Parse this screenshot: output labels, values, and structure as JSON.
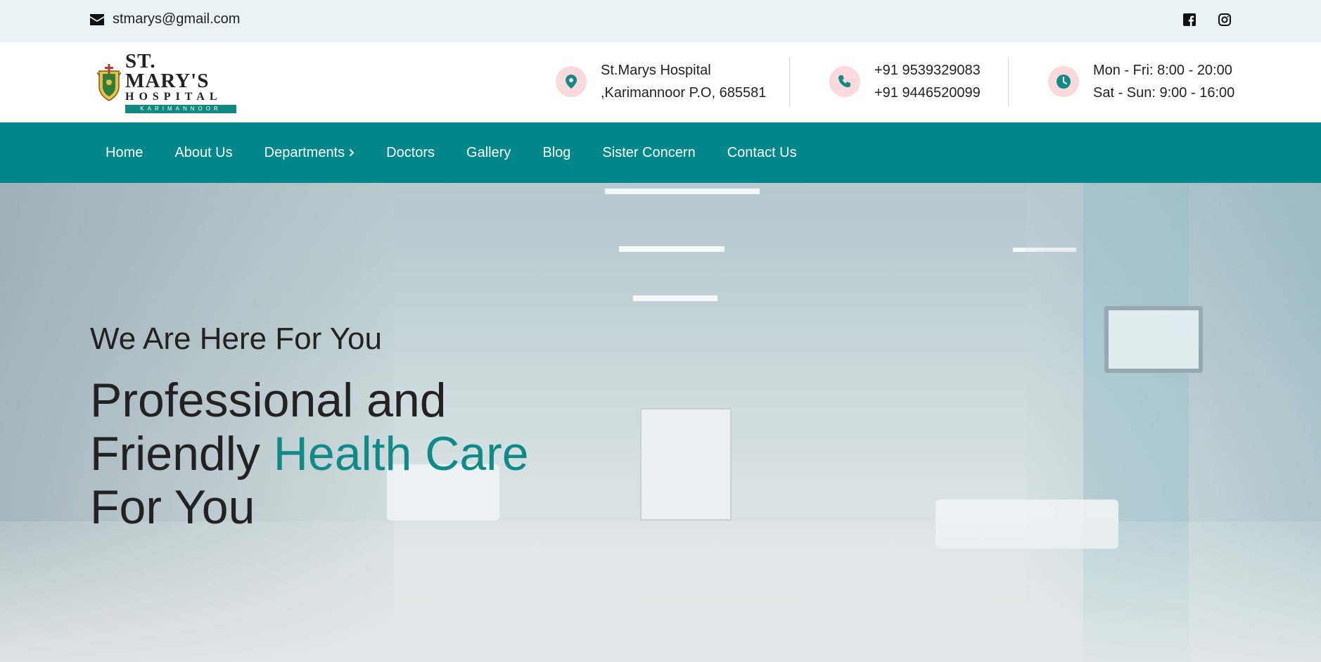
{
  "topbar": {
    "email": "stmarys@gmail.com",
    "email_icon": "envelope-icon",
    "social": [
      {
        "name": "facebook",
        "icon": "facebook-icon"
      },
      {
        "name": "instagram",
        "icon": "instagram-icon"
      }
    ]
  },
  "logo": {
    "title": "ST. MARY'S",
    "subtitle": "HOSPITAL",
    "band": "KARIMANNOOR"
  },
  "contact": {
    "address_line1": "St.Marys Hospital",
    "address_line2": ",Karimannoor P.O, 685581",
    "phone1": "+91 9539329083",
    "phone2": "+91 9446520099",
    "hours1": "Mon - Fri: 8:00 - 20:00",
    "hours2": "Sat - Sun: 9:00 - 16:00"
  },
  "nav": {
    "items": [
      {
        "label": "Home"
      },
      {
        "label": "About Us"
      },
      {
        "label": "Departments"
      },
      {
        "label": "Doctors"
      },
      {
        "label": "Gallery"
      },
      {
        "label": "Blog"
      },
      {
        "label": "Sister Concern"
      },
      {
        "label": "Contact Us"
      }
    ]
  },
  "hero": {
    "tagline": "We Are Here For You",
    "title_part1": "Professional and",
    "title_part2": "Friendly",
    "title_accent": "Health Care",
    "title_part3": "For You"
  },
  "colors": {
    "brand": "#00878a",
    "accent_text": "#0e8a87",
    "icon_circle": "#fbd9dc",
    "topbar_bg": "#e9f3f5"
  }
}
